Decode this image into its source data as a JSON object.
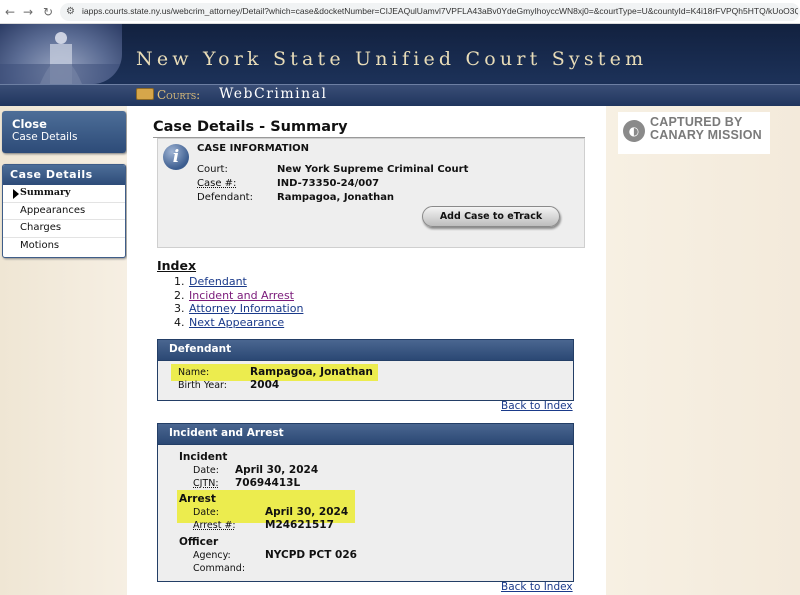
{
  "browser": {
    "url": "iapps.courts.state.ny.us/webcrim_attorney/Detail?which=case&docketNumber=CIJEAQulUamvl7VPFLA43aBv0YdeGmyIhoyccWN8xj0=&courtType=U&countyId=K4i18rFVPQh5HTQ/kUoO3Q==&docketId=3pCoW5t..."
  },
  "banner": {
    "title": "New York State Unified Court System",
    "courts_label": "Courts:",
    "app_name": "WebCriminal"
  },
  "sidebar": {
    "close_line1": "Close",
    "close_line2": "Case Details",
    "section_title": "Case Details",
    "items": [
      {
        "label": "Summary"
      },
      {
        "label": "Appearances"
      },
      {
        "label": "Charges"
      },
      {
        "label": "Motions"
      }
    ]
  },
  "page": {
    "title": "Case Details - Summary"
  },
  "case_info": {
    "heading": "CASE INFORMATION",
    "court_label": "Court:",
    "court_value": "New York Supreme Criminal Court",
    "case_label": "Case #:",
    "case_value": "IND-73350-24/007",
    "defendant_label": "Defendant:",
    "defendant_value": "Rampagoa, Jonathan",
    "etrack_button": "Add Case to eTrack"
  },
  "index": {
    "title": "Index",
    "items": [
      {
        "num": "1.",
        "label": "Defendant"
      },
      {
        "num": "2.",
        "label": "Incident and Arrest"
      },
      {
        "num": "3.",
        "label": "Attorney Information"
      },
      {
        "num": "4.",
        "label": "Next Appearance"
      }
    ]
  },
  "defendant": {
    "heading": "Defendant",
    "name_label": "Name:",
    "name_value": "Rampagoa, Jonathan",
    "birth_label": "Birth Year:",
    "birth_value": "2004",
    "back_link": "Back to Index"
  },
  "incident": {
    "heading": "Incident and Arrest",
    "incident_title": "Incident",
    "date_label": "Date:",
    "date_value": "April 30, 2024",
    "cjtn_label": "CJTN:",
    "cjtn_value": "70694413L",
    "arrest_title": "Arrest",
    "arrest_date_label": "Date:",
    "arrest_date_value": "April 30, 2024",
    "arrest_num_label": "Arrest #:",
    "arrest_num_value": "M24621517",
    "officer_title": "Officer",
    "agency_label": "Agency:",
    "agency_value": "NYCPD PCT 026",
    "command_label": "Command:",
    "back_link": "Back to Index"
  },
  "watermark": {
    "line1": "CAPTURED BY",
    "line2": "CANARY MISSION"
  },
  "colors": {
    "banner_bg": "#1c3158",
    "nav_blue": "#2d4b78",
    "highlight": "#ecec4e",
    "link": "#1a3a8a",
    "visited_link": "#7a1a7a"
  }
}
